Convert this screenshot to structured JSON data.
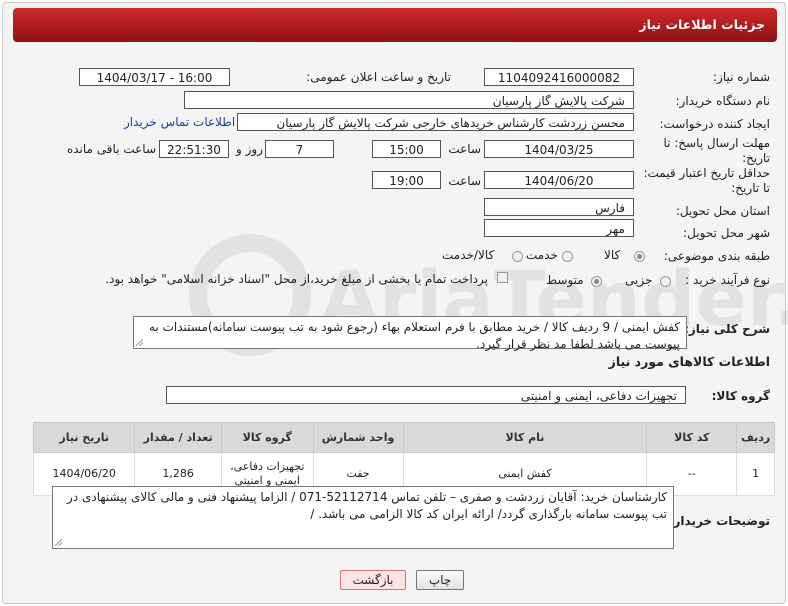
{
  "header": {
    "title": "جزئیات اطلاعات نیاز"
  },
  "fields": {
    "need_number_label": "شماره نیاز:",
    "need_number": "1104092416000082",
    "announce_label": "تاریخ و ساعت اعلان عمومی:",
    "announce_value": "1404/03/17 - 16:00",
    "buyer_org_label": "نام دستگاه خریدار:",
    "buyer_org": "شرکت پالایش گاز پارسیان",
    "creator_label": "ایجاد کننده درخواست:",
    "creator": "محسن زردشت کارشناس خریدهای خارجی شرکت پالایش گاز پارسیان",
    "contact_link": "اطلاعات تماس خریدار",
    "deadline_label": "مهلت ارسال پاسخ: تا تاریخ:",
    "deadline_date": "1404/03/25",
    "time_label": "ساعت",
    "deadline_time": "15:00",
    "days_value": "7",
    "days_label": "روز و",
    "remaining_value": "22:51:30",
    "remaining_label": "ساعت باقی مانده",
    "validity_label": "حداقل تاریخ اعتبار قیمت: تا تاریخ:",
    "validity_date": "1404/06/20",
    "validity_time": "19:00",
    "province_label": "استان محل تحویل:",
    "province": "فارس",
    "city_label": "شهر محل تحویل:",
    "city": "مهر",
    "category_label": "طبقه بندی موضوعی:",
    "category_options": [
      "کالا",
      "خدمت",
      "کالا/خدمت"
    ],
    "process_label": "نوع فرآیند خرید :",
    "process_options": [
      "جزیی",
      "متوسط"
    ],
    "payment_note": "پرداخت تمام یا بخشی از مبلغ خرید،از محل \"اسناد خزانه اسلامی\" خواهد بود."
  },
  "description": {
    "label": "شرح کلی نیاز:",
    "text": "کفش ایمنی / 9 ردیف کالا / خرید مطابق با فرم استعلام بهاء (رجوع شود به تب پیوست سامانه)مستندات به پیوست می باشد لطفا مد نظر قرار گیرد."
  },
  "goods_info": {
    "title": "اطلاعات کالاهای مورد نیاز",
    "group_label": "گروه کالا:",
    "group_value": "تجهیزات دفاعی، ایمنی و امنیتی"
  },
  "table": {
    "headers": [
      "ردیف",
      "کد کالا",
      "نام کالا",
      "واحد شمارش",
      "گروه کالا",
      "تعداد / مقدار",
      "تاریخ نیاز"
    ],
    "rows": [
      [
        "1",
        "--",
        "کفش ایمنی",
        "جفت",
        "تجهیزات دفاعی، ایمنی و امنیتی",
        "1,286",
        "1404/06/20"
      ]
    ]
  },
  "buyer_notes": {
    "label": "توضیحات خریدار:",
    "text": "کارشناسان خرید: آقایان زردشت و صفری – تلفن تماس 52112714-071 / الزاما پیشنهاد فنی و مالی کالای پیشنهادی در تب پیوست سامانه بارگذاری گردد/ ارائه ایران کد کالا الزامی می باشد. /"
  },
  "buttons": {
    "print": "چاپ",
    "back": "بازگشت"
  },
  "watermark": {
    "text": "AriaTender.net"
  },
  "colors": {
    "header": "#b51d1d",
    "link": "#1a3fa0"
  }
}
